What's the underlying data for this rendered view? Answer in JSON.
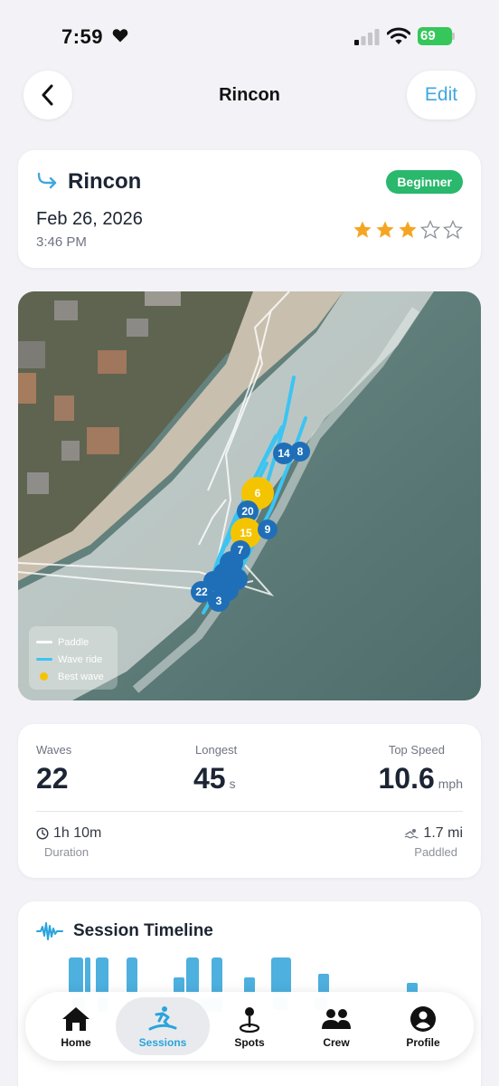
{
  "status_bar": {
    "time": "7:59",
    "battery": "69"
  },
  "nav": {
    "title": "Rincon",
    "edit_label": "Edit"
  },
  "session": {
    "spot": "Rincon",
    "level": "Beginner",
    "date": "Feb 26, 2026",
    "time": "3:46 PM",
    "rating": 3,
    "rating_max": 5
  },
  "map": {
    "legend": {
      "paddle": "Paddle",
      "wave_ride": "Wave ride",
      "best_wave": "Best wave"
    },
    "markers": [
      "14",
      "8",
      "6",
      "20",
      "15",
      "9",
      "7",
      "22",
      "3"
    ],
    "best_wave_markers": [
      "6",
      "15"
    ],
    "colors": {
      "paddle": "#ffffff",
      "wave_ride": "#3cc4f2",
      "best_wave": "#f5c400",
      "marker": "#1f6fb8"
    }
  },
  "stats": {
    "waves": {
      "label": "Waves",
      "value": "22"
    },
    "longest": {
      "label": "Longest",
      "value": "45",
      "unit": "s"
    },
    "top_speed": {
      "label": "Top Speed",
      "value": "10.6",
      "unit": "mph"
    },
    "duration": {
      "label": "Duration",
      "value": "1h 10m"
    },
    "paddled": {
      "label": "Paddled",
      "value": "1.7 mi"
    }
  },
  "timeline": {
    "title": "Session Timeline"
  },
  "tabs": [
    {
      "label": "Home",
      "icon": "home-icon",
      "active": false
    },
    {
      "label": "Sessions",
      "icon": "surfer-icon",
      "active": true
    },
    {
      "label": "Spots",
      "icon": "map-pin-icon",
      "active": false
    },
    {
      "label": "Crew",
      "icon": "people-icon",
      "active": false
    },
    {
      "label": "Profile",
      "icon": "profile-icon",
      "active": false
    }
  ],
  "colors": {
    "accent": "#3fa7df",
    "badge": "#29b86c",
    "star": "#f4a623"
  }
}
